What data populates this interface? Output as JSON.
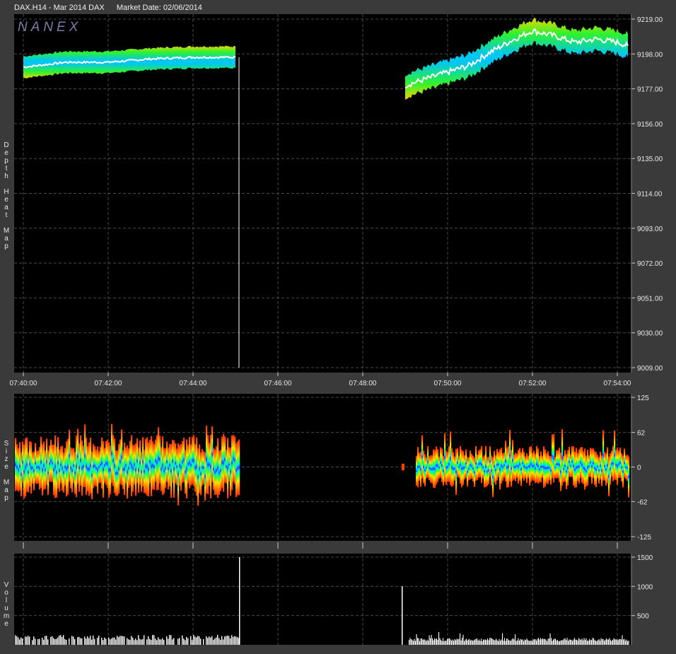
{
  "header": {
    "symbol": "DAX.H14 - Mar 2014 DAX",
    "market_date": "Market Date: 02/06/2014"
  },
  "watermark": "NANEX",
  "panels": {
    "depth": {
      "label": "Depth Heat Map"
    },
    "size": {
      "label": "Size Map"
    },
    "volume": {
      "label": "Volume"
    }
  },
  "colors": {
    "background": "#3a3a3a",
    "plot": "#000000",
    "grid": "#555555",
    "price": "#ffffff"
  },
  "chart_data": [
    {
      "type": "heatmap",
      "title": "Depth Heat Map",
      "x_ticks": [
        "07:40:00",
        "07:42:00",
        "07:44:00",
        "07:46:00",
        "07:48:00",
        "07:50:00",
        "07:52:00",
        "07:54:00"
      ],
      "y_ticks": [
        "9219.00",
        "9198.00",
        "9177.00",
        "9156.00",
        "9135.00",
        "9114.00",
        "9093.00",
        "9072.00",
        "9051.00",
        "9030.00",
        "9009.00"
      ],
      "ylim": [
        9009,
        9219
      ],
      "series": [
        {
          "segment": "pre-gap",
          "x": [
            "07:40:00",
            "07:41:00",
            "07:42:00",
            "07:43:00",
            "07:44:00",
            "07:45:00"
          ],
          "values": [
            9190,
            9193,
            9193,
            9195,
            9196,
            9196
          ]
        },
        {
          "segment": "post-gap",
          "x": [
            "07:49:00",
            "07:49:30",
            "07:50:00",
            "07:50:30",
            "07:51:00",
            "07:51:30",
            "07:52:00",
            "07:52:30",
            "07:53:00",
            "07:53:30",
            "07:54:00",
            "07:54:15"
          ],
          "values": [
            9179,
            9183,
            9187,
            9191,
            9199,
            9206,
            9212,
            9209,
            9205,
            9207,
            9205,
            9203
          ]
        }
      ],
      "gap_marker_time": "07:45:05"
    },
    {
      "type": "area",
      "title": "Size Map",
      "y_ticks": [
        "125",
        "62",
        "0",
        "-62",
        "-125"
      ],
      "ylim": [
        -125,
        125
      ]
    },
    {
      "type": "bar",
      "title": "Volume",
      "y_ticks": [
        "1500",
        "1000",
        "500"
      ],
      "ylim": [
        0,
        1500
      ],
      "spikes": [
        {
          "time": "07:45:05",
          "value": 1500
        },
        {
          "time": "07:48:55",
          "value": 1000
        }
      ]
    }
  ]
}
